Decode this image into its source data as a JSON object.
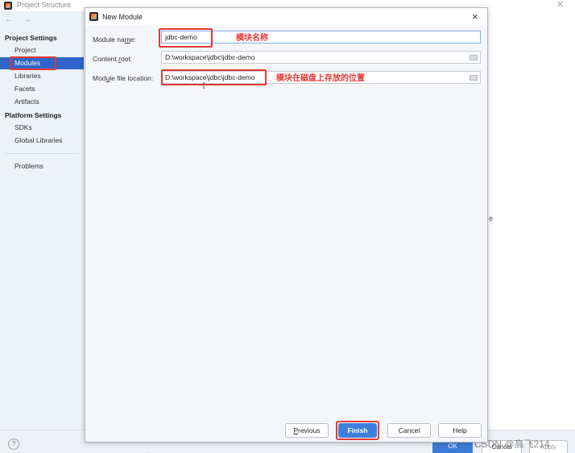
{
  "background_window": {
    "title": "Project Structure",
    "nav_arrows": "← →",
    "sidebar": {
      "project_settings_header": "Project Settings",
      "project_settings_items": [
        "Project",
        "Modules",
        "Libraries",
        "Facets",
        "Artifacts"
      ],
      "platform_settings_header": "Platform Settings",
      "platform_settings_items": [
        "SDKs",
        "Global Libraries"
      ],
      "problems": "Problems",
      "selected_item": "Modules"
    },
    "right_fragment": "e",
    "bottom": {
      "help": "?",
      "ok": "OK",
      "cancel": "Cancel",
      "apply": "Apply",
      "faint_text": "…"
    },
    "watermark": "CSDN @高飞214"
  },
  "dialog": {
    "title": "New Module",
    "close": "×",
    "fields": {
      "module_name": {
        "label_pre": "Module na",
        "label_u": "m",
        "label_post": "e:",
        "value": "jdbc-demo"
      },
      "content_root": {
        "label_pre": "Content ",
        "label_u": "r",
        "label_post": "oot:",
        "value": "D:\\workspace\\jdbc\\jdbc-demo"
      },
      "module_file_location": {
        "label_pre": "Mod",
        "label_u": "u",
        "label_post": "le file location:",
        "value": "D:\\workspace\\jdbc\\jdbc-demo"
      }
    },
    "annotations": {
      "module_name_note": "模块名称",
      "location_note": "模块在磁盘上存放的位置"
    },
    "buttons": {
      "previous_u": "P",
      "previous_rest": "revious",
      "finish": "Finish",
      "cancel": "Cancel",
      "help": "Help"
    }
  },
  "colors": {
    "accent_blue": "#2f65ca",
    "annotation_red": "#e53935"
  }
}
